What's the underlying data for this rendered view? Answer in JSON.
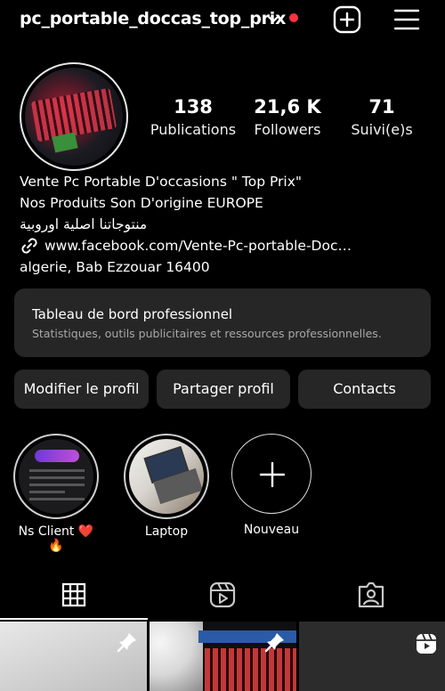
{
  "header": {
    "username": "pc_portable_doccas_top_prix",
    "icons": [
      "chevron-down-icon",
      "notification-dot",
      "add-icon",
      "menu-icon"
    ],
    "accent_color": "#ff3040"
  },
  "profile": {
    "stats": [
      {
        "value": "138",
        "label": "Publications"
      },
      {
        "value": "21,6 K",
        "label": "Followers"
      },
      {
        "value": "71",
        "label": "Suivi(e)s"
      }
    ],
    "bio": {
      "name": "Vente Pc Portable D'occasions \" Top Prix\"",
      "line1": "Nos Produits Son D'origine EUROPE",
      "arabic": "منتوجاتنا اصلية اوروبية",
      "link": "www.facebook.com/Vente-Pc-portable-Doc…",
      "location": "algerie, Bab Ezzouar 16400"
    }
  },
  "dashboard": {
    "title": "Tableau de bord professionnel",
    "subtitle": "Statistiques, outils publicitaires et ressources professionnelles."
  },
  "buttons": {
    "edit": "Modifier le profil",
    "share": "Partager profil",
    "contacts": "Contacts"
  },
  "highlights": [
    {
      "label": "Ns Client ❤️🔥"
    },
    {
      "label": "Laptop"
    },
    {
      "label": "Nouveau"
    }
  ],
  "tabs": [
    "grid-icon",
    "reels-icon",
    "tagged-icon"
  ]
}
